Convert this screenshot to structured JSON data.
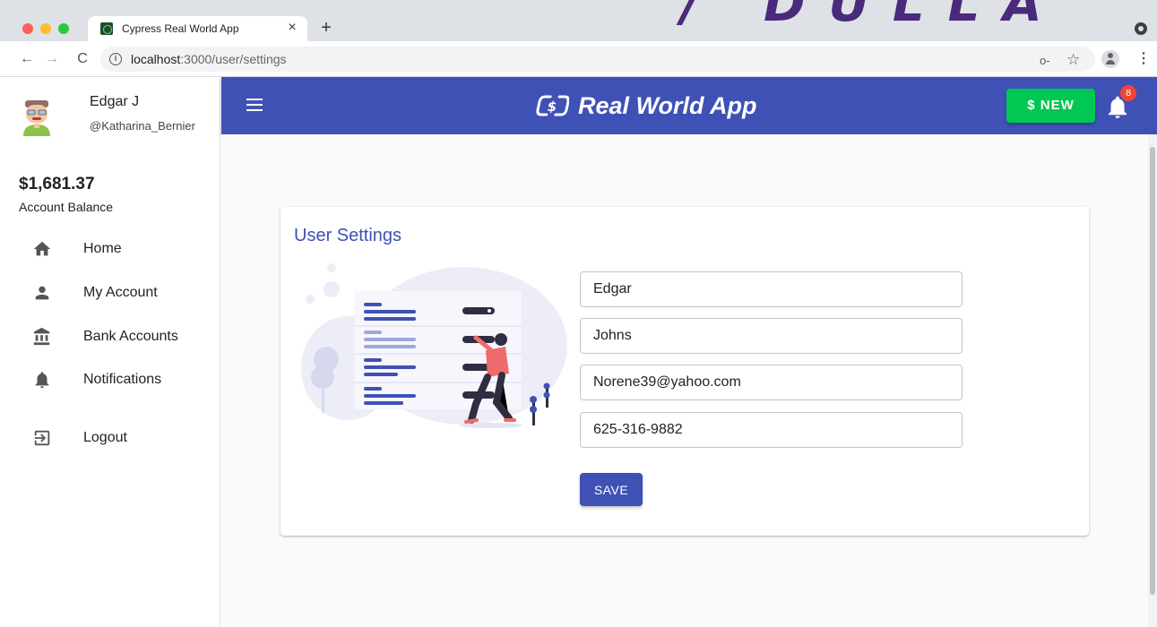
{
  "browser": {
    "tab_title": "Cypress Real World App",
    "tab_close": "×",
    "new_tab": "+",
    "url_host": "localhost",
    "url_path": ":3000/user/settings",
    "back": "←",
    "forward": "→",
    "reload": "C",
    "info": "i",
    "key": "o-",
    "star": "☆",
    "menu": "⋮",
    "promo_text": "/ DULLA"
  },
  "sidebar": {
    "user_name": "Edgar J",
    "user_handle": "@Katharina_Bernier",
    "balance": "$1,681.37",
    "balance_label": "Account Balance",
    "items": [
      {
        "label": "Home",
        "icon": "home-icon"
      },
      {
        "label": "My Account",
        "icon": "person-icon"
      },
      {
        "label": "Bank Accounts",
        "icon": "bank-icon"
      },
      {
        "label": "Notifications",
        "icon": "bell-icon"
      },
      {
        "label": "Logout",
        "icon": "logout-icon"
      }
    ]
  },
  "header": {
    "brand": "Real World App",
    "new_button": "$ NEW",
    "notification_count": "8"
  },
  "settings": {
    "title": "User Settings",
    "first_name": "Edgar",
    "last_name": "Johns",
    "email": "Norene39@yahoo.com",
    "phone": "625-316-9882",
    "save_label": "SAVE"
  },
  "colors": {
    "primary": "#3f51b5",
    "new_button": "#00c853",
    "badge": "#f44336",
    "illustration_accent": "#ef6c6c"
  }
}
